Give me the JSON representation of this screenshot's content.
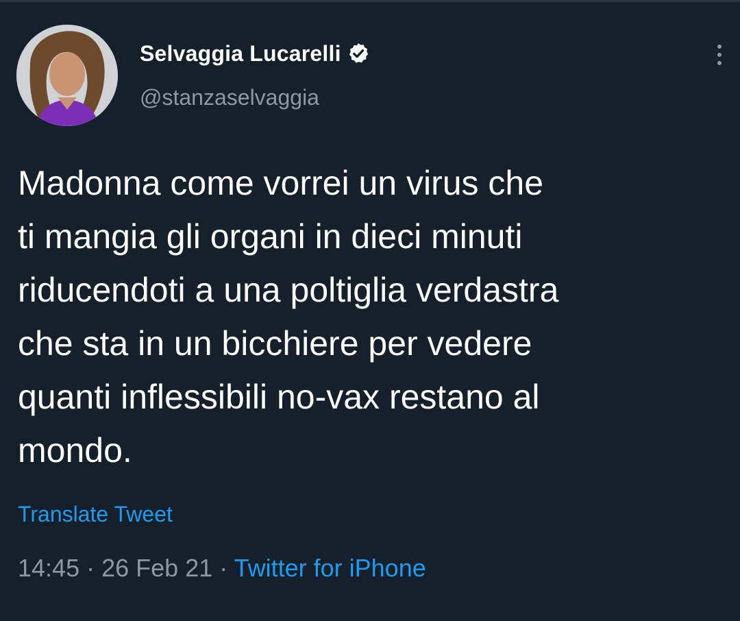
{
  "tweet": {
    "author": {
      "display_name": "Selvaggia Lucarelli",
      "handle": "@stanzaselvaggia",
      "verified": true
    },
    "text_lines": [
      "Madonna come vorrei un virus che",
      "ti mangia gli organi in dieci minuti",
      "riducendoti a una poltiglia verdastra",
      "che sta in un bicchiere per vedere",
      "quanti inflessibili no-vax restano al",
      "mondo."
    ],
    "translate_label": "Translate Tweet",
    "time": "14:45",
    "separator": "·",
    "date": "26 Feb 21",
    "source": "Twitter for iPhone"
  },
  "icons": {
    "verified": "verified-badge-icon",
    "more": "more-options-icon"
  },
  "colors": {
    "background": "#15202b",
    "text": "#ffffff",
    "secondary_text": "#8b98a5",
    "link": "#1d9bf0"
  }
}
